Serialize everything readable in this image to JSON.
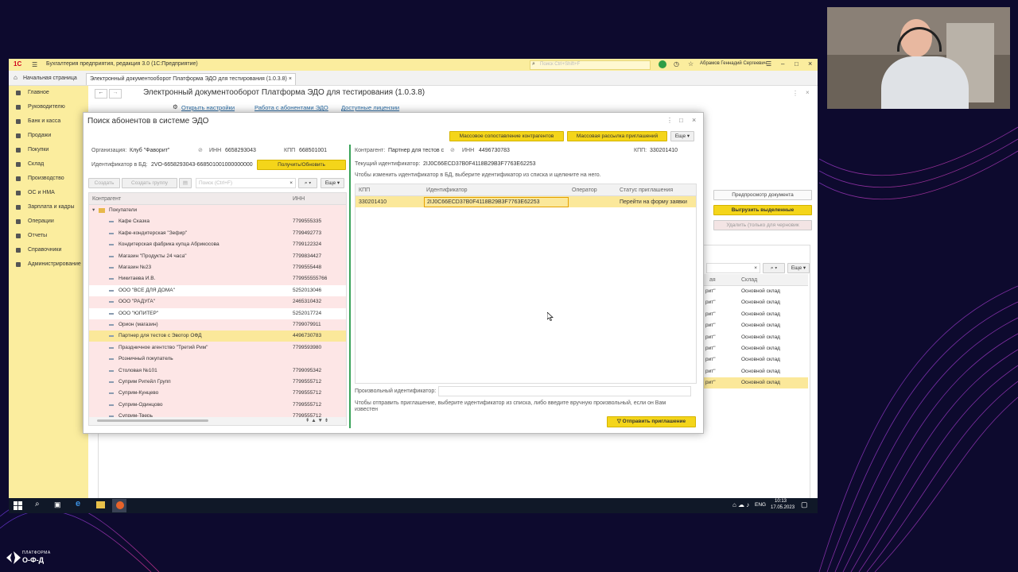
{
  "window": {
    "title": "Бухгалтерия предприятия, редакция 3.0  (1С:Предприятие)",
    "search_placeholder": "Поиск Ctrl+Shift+F",
    "user": "Абрамов Геннадий Сергеевич",
    "logo": "1С"
  },
  "tabs": [
    {
      "label": "Начальная страница"
    },
    {
      "label": "Электронный документооборот Платформа ЭДО для тестирования (1.0.3.8)"
    }
  ],
  "sidebar": {
    "items": [
      {
        "label": "Главное"
      },
      {
        "label": "Руководителю"
      },
      {
        "label": "Банк и касса"
      },
      {
        "label": "Продажи"
      },
      {
        "label": "Покупки"
      },
      {
        "label": "Склад"
      },
      {
        "label": "Производство"
      },
      {
        "label": "ОС и НМА"
      },
      {
        "label": "Зарплата и кадры"
      },
      {
        "label": "Операции"
      },
      {
        "label": "Отчеты"
      },
      {
        "label": "Справочники"
      },
      {
        "label": "Администрирование"
      }
    ]
  },
  "background_doc": {
    "title": "Электронный документооборот Платформа ЭДО для тестирования (1.0.3.8)",
    "links": [
      "Открыть настройки",
      "Работа с абонентами ЭДО",
      "Доступные лицензии"
    ],
    "preview_btn": "Предпросмотр документа",
    "upload_btn": "Выгрузить выделенные",
    "delete_btn": "Удалить (только для черновик",
    "more": "Еще",
    "col_a": "ая",
    "col_warehouse": "Склад",
    "rows": [
      {
        "a": "рит\"",
        "w": "Основной склад"
      },
      {
        "a": "рит\"",
        "w": "Основной склад"
      },
      {
        "a": "рит\"",
        "w": "Основной склад"
      },
      {
        "a": "рит\"",
        "w": "Основной склад"
      },
      {
        "a": "рит\"",
        "w": "Основной склад"
      },
      {
        "a": "рит\"",
        "w": "Основной склад"
      },
      {
        "a": "рит\"",
        "w": "Основной склад"
      },
      {
        "a": "рит\"",
        "w": "Основной склад"
      },
      {
        "a": "рит\"",
        "w": "Основной склад"
      }
    ]
  },
  "modal": {
    "title": "Поиск абонентов в системе ЭДО",
    "btn_bulk_match": "Массовое сопоставление контрагентов",
    "btn_bulk_invite": "Массовая рассылка приглашений",
    "more": "Еще",
    "org_label": "Организация:",
    "org_value": "Клуб \"Фаворит\"",
    "inn_label": "ИНН",
    "org_inn": "6658293043",
    "kpp_label": "КПП",
    "org_kpp": "668501001",
    "id_label": "Идентификатор в БД:",
    "id_value": "2VO-6658293043-668501001000000000",
    "refresh_btn": "Получить/Обновить",
    "create_btn": "Создать",
    "create_group_btn": "Создать группу",
    "search_placeholder": "Поиск (Ctrl+F)",
    "col_counterparty": "Контрагент",
    "col_inn": "ИНН",
    "group": "Покупатели",
    "list": [
      {
        "name": "Кафе Сказка",
        "inn": "7799555335"
      },
      {
        "name": "Кафе-кондитерская \"Зефир\"",
        "inn": "7799492773"
      },
      {
        "name": "Кондитерская фабрика купца Абрикосова",
        "inn": "7799122324"
      },
      {
        "name": "Магазин \"Продукты 24 часа\"",
        "inn": "7799834427"
      },
      {
        "name": "Магазин №23",
        "inn": "7799555448"
      },
      {
        "name": "Никитаева И.В.",
        "inn": "779955555766"
      },
      {
        "name": "ООО \"ВСЕ ДЛЯ ДОМА\"",
        "inn": "5252013046"
      },
      {
        "name": "ООО \"РАДУГА\"",
        "inn": "2465310432"
      },
      {
        "name": "ООО \"ЮПИТЕР\"",
        "inn": "5252017724"
      },
      {
        "name": "Орион (магазин)",
        "inn": "7799079911"
      },
      {
        "name": "Партнер для тестов с Эвотор ОФД",
        "inn": "4496730783"
      },
      {
        "name": "Праздничное агентство \"Третий Рим\"",
        "inn": "7799593980"
      },
      {
        "name": "Розничный покупатель",
        "inn": ""
      },
      {
        "name": "Столовая №101",
        "inn": "7799095342"
      },
      {
        "name": "Суприм Ритейл Групп",
        "inn": "7799555712"
      },
      {
        "name": "Суприм-Кунцево",
        "inn": "7799555712"
      },
      {
        "name": "Суприм-Одинцово",
        "inn": "7799555712"
      },
      {
        "name": "Суприм-Тверь",
        "inn": "7799555712"
      }
    ],
    "cp_label": "Контрагент:",
    "cp_value": "Партнер для тестов с",
    "cp_inn": "4496730783",
    "cp_kpp_label": "КПП:",
    "cp_kpp": "330201410",
    "current_id_label": "Текущий идентификатор:",
    "current_id": "2IJ0C66ECD37B0F4118B29B3F7763E62253",
    "hint_change": "Чтобы изменить идентификатор в БД, выберите идентификатор из списка и щелкните на него.",
    "grid_headers": [
      "КПП",
      "Идентификатор",
      "Оператор",
      "Статус приглашения"
    ],
    "grid_row": {
      "kpp": "330201410",
      "id": "2IJ0C66ECD37B0F4118B29B3F7763E62253",
      "operator": "",
      "status": "Перейти на форму заявки"
    },
    "custom_id_label": "Произвольный идентификатор:",
    "hint_send": "Чтобы отправить приглашение, выберите идентификатор из списка, либо введите вручную произвольный, если он Вам известен",
    "send_btn": "Отправить приглашение"
  },
  "taskbar": {
    "lang": "ENG",
    "time": "10:13",
    "date": "17.05.2023"
  },
  "brand": {
    "line1": "ПЛАТФОРМА",
    "line2": "О-Ф-Д"
  },
  "colors": {
    "accent_yellow": "#f4d51a",
    "sidebar_yellow": "#fbed9e",
    "list_pink": "#fde6e6",
    "selected_row": "#fbe89a"
  }
}
